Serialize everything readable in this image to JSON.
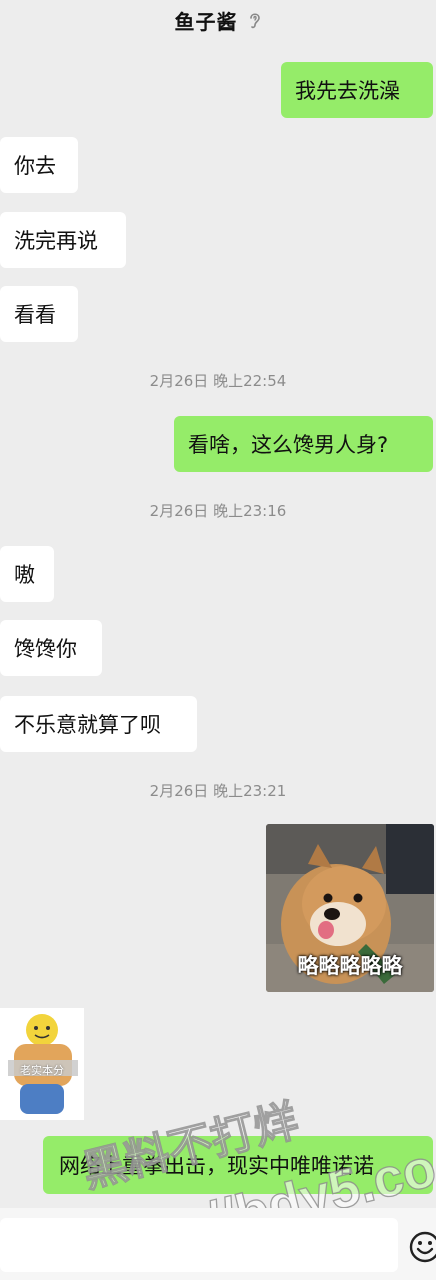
{
  "header": {
    "title": "鱼子酱",
    "icon": "ear-icon"
  },
  "messages": [
    {
      "side": "right",
      "text": "我先去洗澡"
    },
    {
      "side": "left",
      "text": "你去"
    },
    {
      "side": "left",
      "text": "洗完再说"
    },
    {
      "side": "left",
      "text": "看看"
    },
    {
      "side": "time",
      "text": "2月26日 晚上22:54"
    },
    {
      "side": "right",
      "text": "看啥，这么馋男人身?"
    },
    {
      "side": "time",
      "text": "2月26日 晚上23:16"
    },
    {
      "side": "left",
      "text": "嗷"
    },
    {
      "side": "left",
      "text": "馋馋你"
    },
    {
      "side": "left",
      "text": "不乐意就算了呗"
    },
    {
      "side": "time",
      "text": "2月26日 晚上23:21"
    },
    {
      "side": "right",
      "sticker": "dog-sticker",
      "caption": "略略略略略"
    },
    {
      "side": "left",
      "sticker": "bear-sticker",
      "caption": "老实本分"
    },
    {
      "side": "right",
      "text": "网络上重拳出击，现实中唯唯诺诺"
    }
  ],
  "watermark": {
    "line1": "黑料不打烊",
    "line2": "https://bdy5.co"
  },
  "input_bar": {
    "emoji_icon": "emoji-icon"
  },
  "colors": {
    "background": "#ededed",
    "sent_bubble": "#95ec69",
    "received_bubble": "#ffffff",
    "timestamp": "#8c8c8c"
  }
}
